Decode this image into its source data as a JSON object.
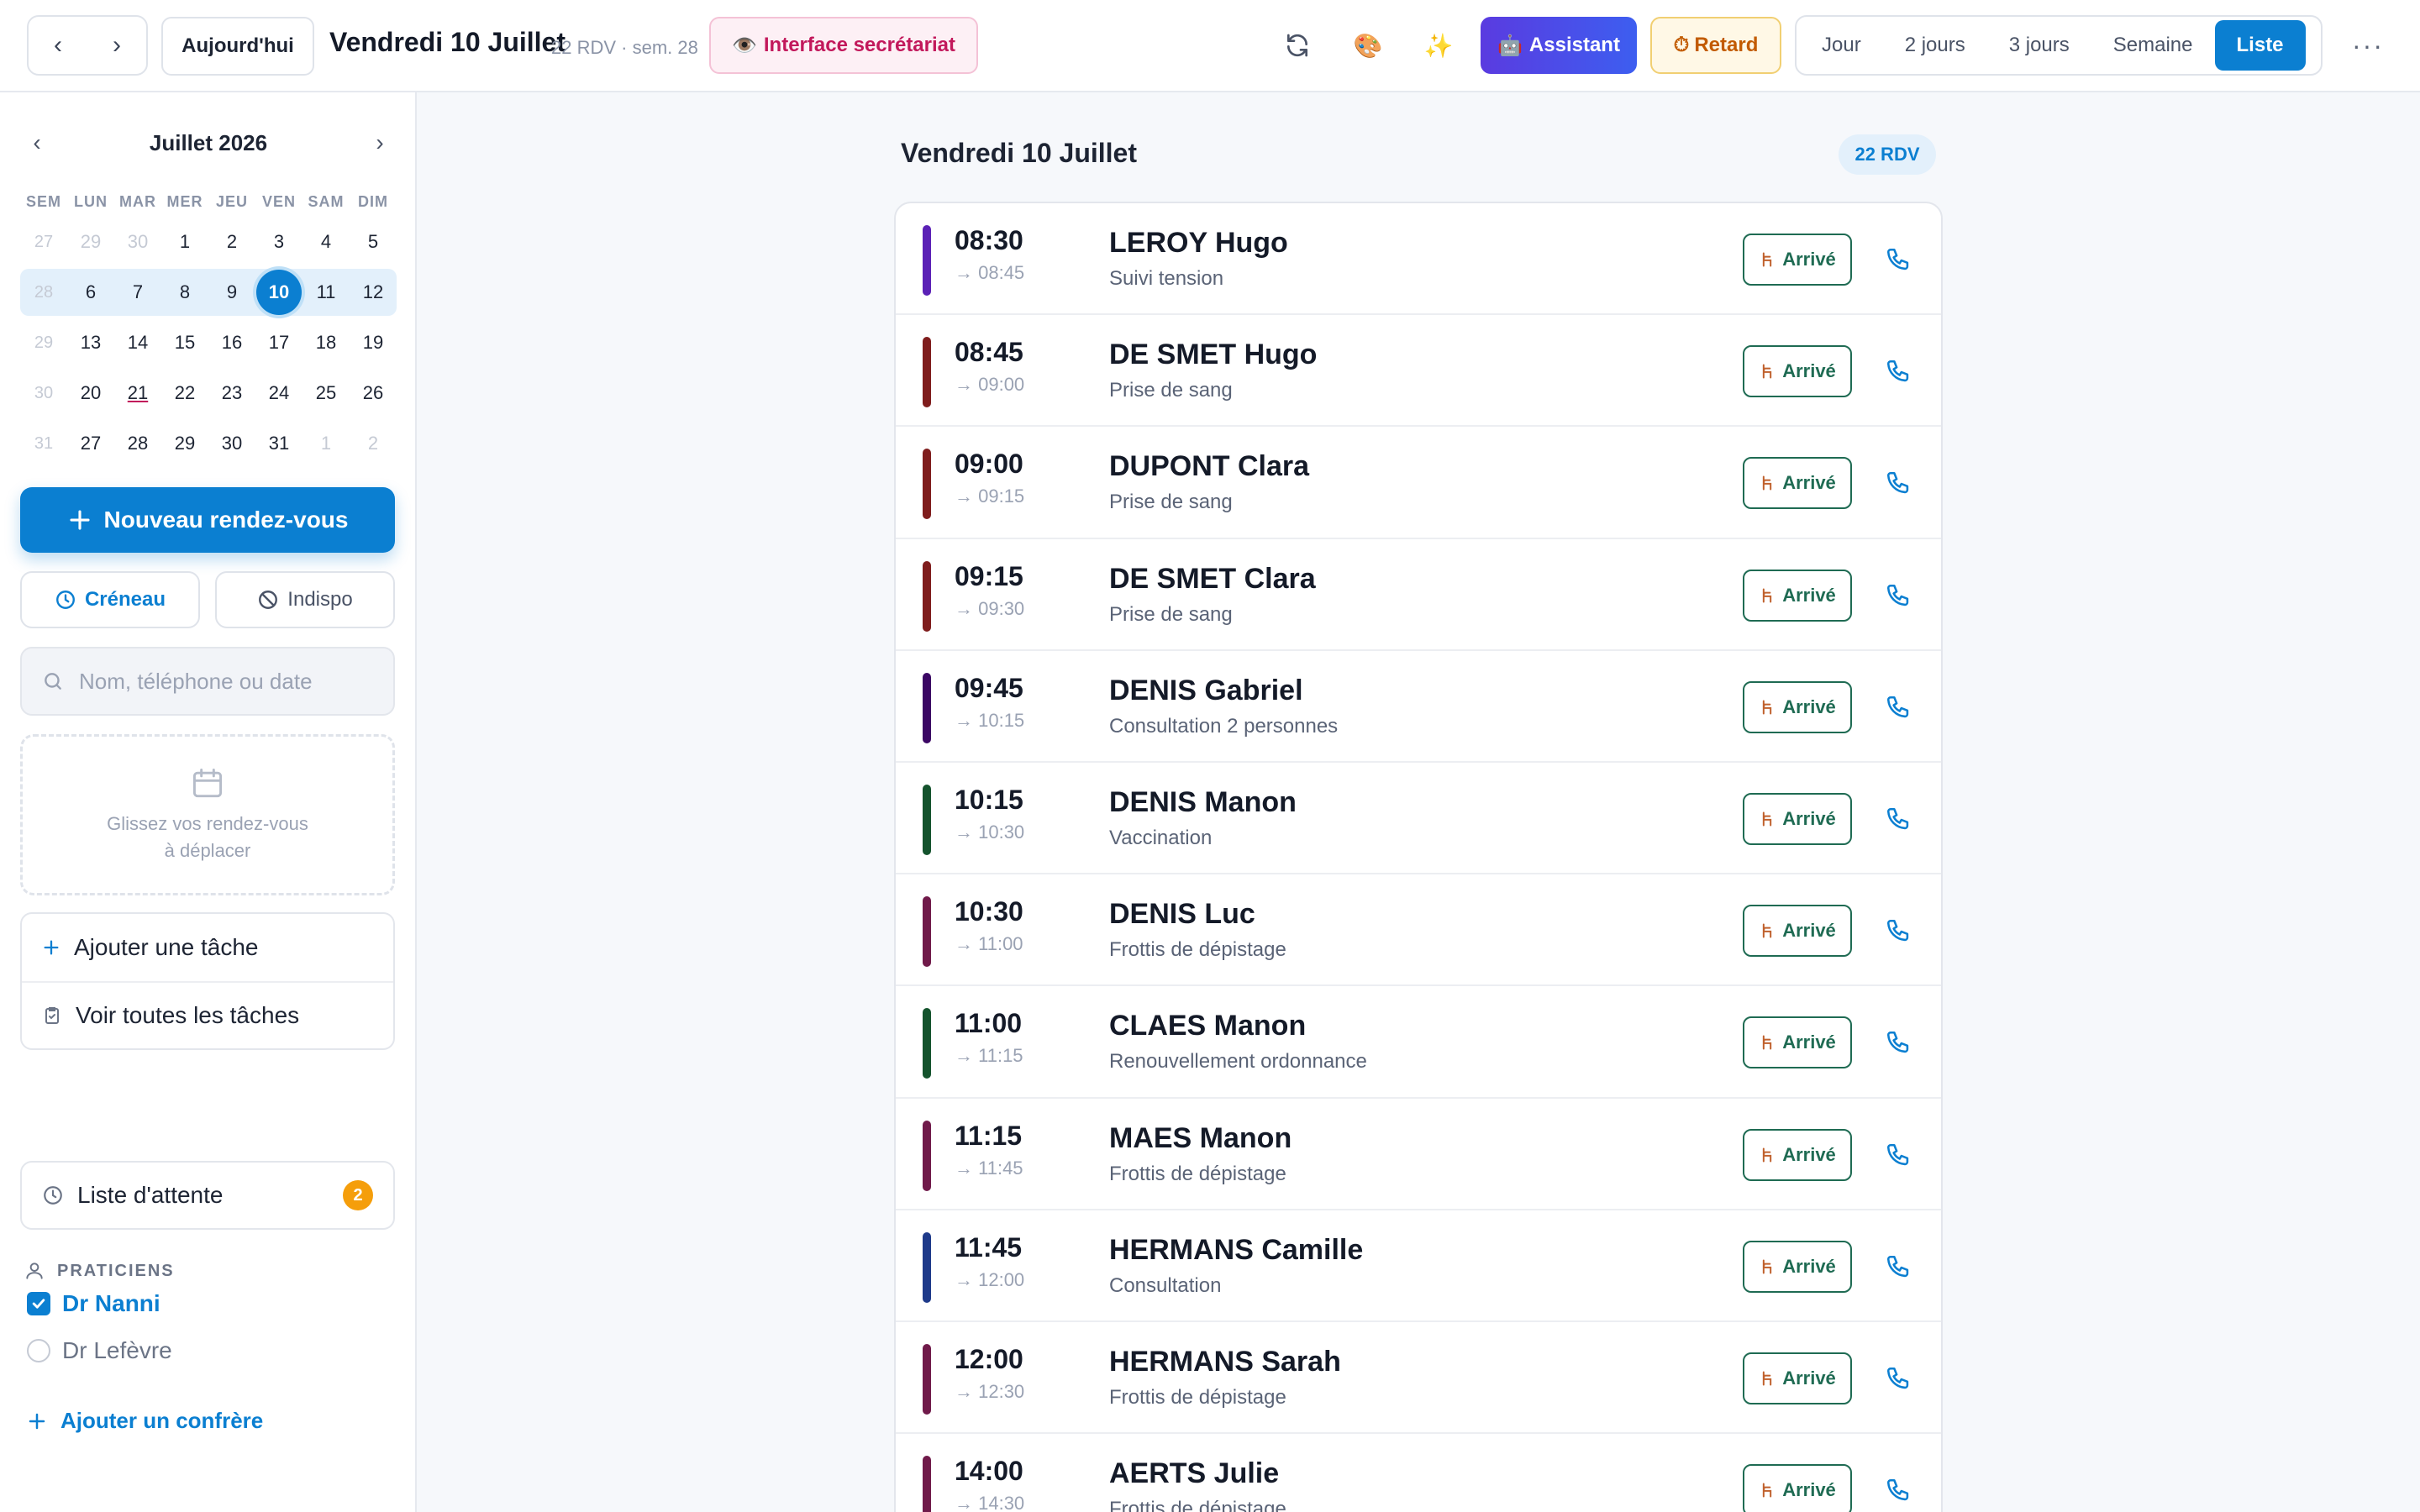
{
  "topbar": {
    "prev_label": "‹",
    "next_label": "›",
    "today_label": "Aujourd'hui",
    "title": "Vendredi 10 Juillet",
    "meta": "22 RDV · sem. 28",
    "secretariat_label": "Interface secrétariat",
    "secretariat_emoji": "👁️",
    "refresh_icon": "refresh-icon",
    "palette_emoji": "🎨",
    "sparkle_emoji": "✨",
    "assistant_emoji": "🤖",
    "assistant_label": "Assistant",
    "retard_emoji": "⏱",
    "retard_label": "Retard",
    "views": [
      "Jour",
      "2 jours",
      "3 jours",
      "Semaine",
      "Liste"
    ],
    "active_view": "Liste",
    "more_label": "···"
  },
  "sidebar": {
    "mini_calendar": {
      "month_label": "Juillet 2026",
      "prev": "‹",
      "next": "›",
      "headers": [
        "SEM",
        "LUN",
        "MAR",
        "MER",
        "JEU",
        "VEN",
        "SAM",
        "DIM"
      ],
      "weeks": [
        {
          "wk": "27",
          "days": [
            "29",
            "30",
            "1",
            "2",
            "3",
            "4",
            "5"
          ],
          "out": [
            0,
            1
          ]
        },
        {
          "wk": "28",
          "days": [
            "6",
            "7",
            "8",
            "9",
            "10",
            "11",
            "12"
          ],
          "out": [],
          "selected": true,
          "today": 4
        },
        {
          "wk": "29",
          "days": [
            "13",
            "14",
            "15",
            "16",
            "17",
            "18",
            "19"
          ],
          "out": []
        },
        {
          "wk": "30",
          "days": [
            "20",
            "21",
            "22",
            "23",
            "24",
            "25",
            "26"
          ],
          "out": [],
          "underline": 1
        },
        {
          "wk": "31",
          "days": [
            "27",
            "28",
            "29",
            "30",
            "31",
            "1",
            "2"
          ],
          "out": [
            5,
            6
          ]
        }
      ]
    },
    "new_appt_label": "Nouveau rendez-vous",
    "slot_label": "Créneau",
    "indispo_label": "Indispo",
    "search_placeholder": "Nom, téléphone ou date",
    "drop_zone_text": [
      "Glissez vos rendez-vous",
      "à déplacer"
    ],
    "add_task_label": "Ajouter une tâche",
    "all_tasks_label": "Voir toutes les tâches",
    "waitlist_label": "Liste d'attente",
    "waitlist_count": "2",
    "practitioners_header": "PRATICIENS",
    "practitioners": [
      {
        "name": "Dr Nanni",
        "checked": true
      },
      {
        "name": "Dr Lefèvre",
        "checked": false
      }
    ],
    "add_colleague_label": "Ajouter un confrère"
  },
  "main": {
    "title": "Vendredi 10 Juillet",
    "count_label": "22 RDV",
    "arrive_label": "Arrivé",
    "appointments": [
      {
        "time": "08:30",
        "end": "→ 08:45",
        "name": "LEROY Hugo",
        "reason": "Suivi tension",
        "color": "#5b21b6"
      },
      {
        "time": "08:45",
        "end": "→ 09:00",
        "name": "DE SMET Hugo",
        "reason": "Prise de sang",
        "color": "#7f1d1d"
      },
      {
        "time": "09:00",
        "end": "→ 09:15",
        "name": "DUPONT Clara",
        "reason": "Prise de sang",
        "color": "#7f1d1d"
      },
      {
        "time": "09:15",
        "end": "→ 09:30",
        "name": "DE SMET Clara",
        "reason": "Prise de sang",
        "color": "#7f1d1d"
      },
      {
        "time": "09:45",
        "end": "→ 10:15",
        "name": "DENIS Gabriel",
        "reason": "Consultation 2 personnes",
        "color": "#3b0764"
      },
      {
        "time": "10:15",
        "end": "→ 10:30",
        "name": "DENIS Manon",
        "reason": "Vaccination",
        "color": "#14532d"
      },
      {
        "time": "10:30",
        "end": "→ 11:00",
        "name": "DENIS Luc",
        "reason": "Frottis de dépistage",
        "color": "#701a4a"
      },
      {
        "time": "11:00",
        "end": "→ 11:15",
        "name": "CLAES Manon",
        "reason": "Renouvellement ordonnance",
        "color": "#14532d"
      },
      {
        "time": "11:15",
        "end": "→ 11:45",
        "name": "MAES Manon",
        "reason": "Frottis de dépistage",
        "color": "#701a4a"
      },
      {
        "time": "11:45",
        "end": "→ 12:00",
        "name": "HERMANS Camille",
        "reason": "Consultation",
        "color": "#1e3a8a"
      },
      {
        "time": "12:00",
        "end": "→ 12:30",
        "name": "HERMANS Sarah",
        "reason": "Frottis de dépistage",
        "color": "#701a4a"
      },
      {
        "time": "14:00",
        "end": "→ 14:30",
        "name": "AERTS Julie",
        "reason": "Frottis de dépistage",
        "color": "#701a4a"
      }
    ]
  }
}
